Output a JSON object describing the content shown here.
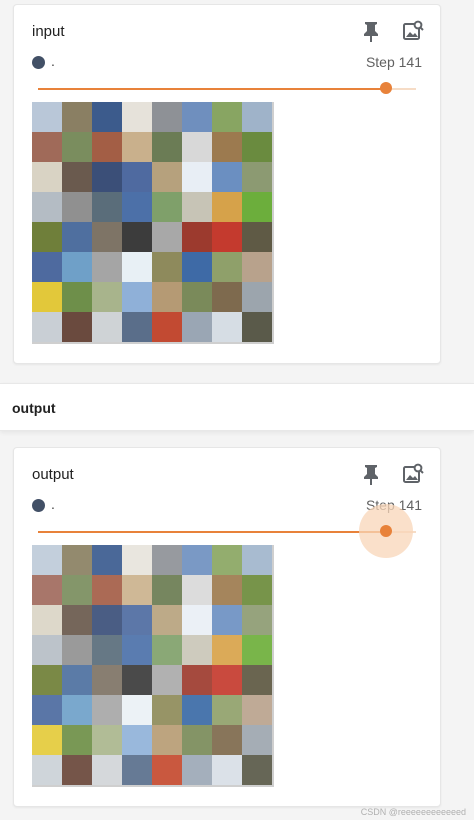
{
  "input_card": {
    "title": "input",
    "run_label": ".",
    "step_label": "Step 141",
    "slider_fraction": 0.92,
    "icons": [
      "pin-icon",
      "image-search-icon"
    ],
    "grid_tiles": [
      "#b9c7d8",
      "#8a7f63",
      "#3c5b8c",
      "#e6e2da",
      "#8e9196",
      "#6f8fbe",
      "#88a562",
      "#9fb3c9",
      "#a06a59",
      "#7a8d5e",
      "#a35e45",
      "#c9b08c",
      "#6b7c55",
      "#d8d8d8",
      "#9c7a4f",
      "#6a8b3f",
      "#d9d3c4",
      "#6a5a4e",
      "#3b4f78",
      "#4f6aa0",
      "#b6a17d",
      "#e8eef5",
      "#6b8fc1",
      "#8c9a72",
      "#b4bcc4",
      "#909090",
      "#5a6d7a",
      "#4c70a8",
      "#7fa06a",
      "#c7c4b6",
      "#d6a24a",
      "#6cae3c",
      "#6f7f3a",
      "#4f6f9f",
      "#7e7466",
      "#3c3c3c",
      "#a8a8a8",
      "#9c3a2e",
      "#c43a2e",
      "#5f5a45",
      "#4e6a9f",
      "#6fa0c8",
      "#a5a5a5",
      "#e8f0f5",
      "#8e8a5c",
      "#3e6aa6",
      "#8fa06a",
      "#b8a28c",
      "#e2c83a",
      "#6e8f4a",
      "#a8b48c",
      "#8fb0d8",
      "#b59a74",
      "#7a8a5a",
      "#7e6a4e",
      "#9ca5ad",
      "#c9cfd5",
      "#6a4a3e",
      "#cfd3d6",
      "#5a6e8a",
      "#c24a32",
      "#9aa6b4",
      "#d6dde4",
      "#5a5a4a"
    ]
  },
  "section": {
    "title": "output"
  },
  "output_card": {
    "title": "output",
    "run_label": ".",
    "step_label": "Step 141",
    "slider_fraction": 0.92,
    "icons": [
      "pin-icon",
      "image-search-icon"
    ],
    "grid_tiles": [
      "#c3cfdc",
      "#938a6e",
      "#4a6898",
      "#e9e6df",
      "#979a9f",
      "#7a99c5",
      "#93ad6e",
      "#a8bbd0",
      "#a8766a",
      "#84966a",
      "#ab6a55",
      "#cfb896",
      "#76865f",
      "#dcdcdc",
      "#a5855c",
      "#77944a",
      "#ddd8ca",
      "#75665a",
      "#4a5d84",
      "#5c77a8",
      "#bdaa88",
      "#ebf0f6",
      "#7899c7",
      "#96a37d",
      "#bcc3ca",
      "#9a9a9a",
      "#667885",
      "#5a7cb0",
      "#8aa876",
      "#cecbbe",
      "#dbaa58",
      "#79b54a",
      "#7a8946",
      "#5b7ba7",
      "#887e71",
      "#4a4a4a",
      "#b1b1b1",
      "#a54a3e",
      "#c94a3e",
      "#6a6550",
      "#5a76a7",
      "#7aa8cd",
      "#aeaeae",
      "#ecf2f6",
      "#979466",
      "#4a76ad",
      "#99a876",
      "#bfaa96",
      "#e6cf4a",
      "#799855",
      "#b1bc96",
      "#99b8dc",
      "#bda47f",
      "#849466",
      "#88755a",
      "#a5adb5",
      "#cfd5da",
      "#755549",
      "#d5d8db",
      "#667a95",
      "#c9583f",
      "#a4afbc",
      "#dbe1e8",
      "#666656"
    ]
  },
  "watermark": "CSDN @reeeeeeeeeeeed"
}
